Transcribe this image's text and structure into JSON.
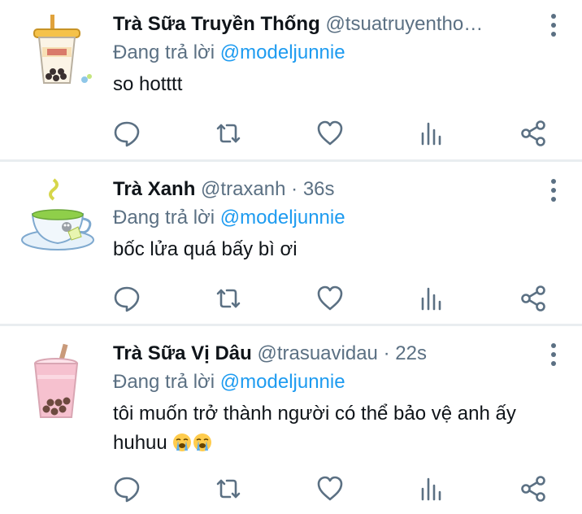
{
  "colors": {
    "text": "#0f1419",
    "secondary": "#5b7083",
    "link": "#1d9bf0",
    "divider": "#e9edf0"
  },
  "tweets": [
    {
      "name": "Trà Sữa Truyền Thống",
      "handle": "@tsuatruyentho…",
      "time": "",
      "reply_prefix": "Đang trả lời",
      "reply_to": "@modeljunnie",
      "text": "so hotttt",
      "avatar": "bubble-tea-cup-icon"
    },
    {
      "name": "Trà Xanh",
      "handle": "@traxanh",
      "separator": "·",
      "time": "36s",
      "reply_prefix": "Đang trả lời",
      "reply_to": "@modeljunnie",
      "text": "bốc lửa quá bấy bì ơi",
      "avatar": "green-tea-cup-icon"
    },
    {
      "name": "Trà Sữa Vị Dâu",
      "handle": "@trasuavidau",
      "separator": "·",
      "time": "22s",
      "reply_prefix": "Đang trả lời",
      "reply_to": "@modeljunnie",
      "text": "tôi muốn trở thành người có thể bảo vệ anh ấy huhuu",
      "emoji": [
        "loudly-crying-face-icon",
        "loudly-crying-face-icon"
      ],
      "avatar": "strawberry-milk-tea-icon"
    }
  ],
  "action_icons": [
    "reply-icon",
    "retweet-icon",
    "like-icon",
    "views-icon",
    "share-icon"
  ]
}
